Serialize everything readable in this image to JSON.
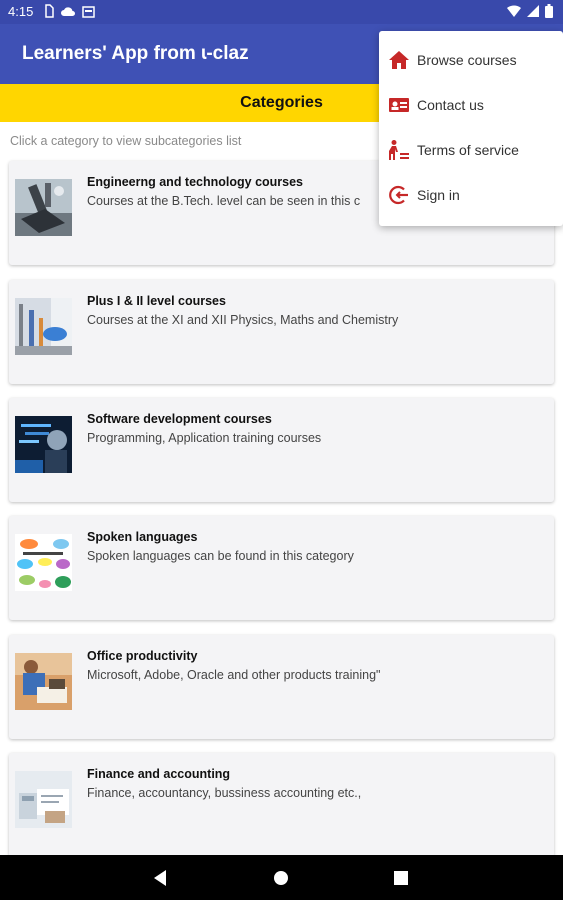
{
  "status": {
    "time": "4:15"
  },
  "app": {
    "title": "Learners' App from ɩ-claz"
  },
  "category_bar": {
    "label": "Categories"
  },
  "hint": "Click a category to view subcategories list",
  "categories": [
    {
      "title": "Engineerng and technology courses",
      "desc": "Courses at the B.Tech. level can be seen in this c",
      "icon": "engineering-thumbnail"
    },
    {
      "title": "Plus I & II level courses",
      "desc": "Courses at the XI and XII Physics, Maths and Chemistry",
      "icon": "lab-thumbnail"
    },
    {
      "title": "Software development courses",
      "desc": "Programming, Application training courses",
      "icon": "software-thumbnail"
    },
    {
      "title": "Spoken languages",
      "desc": "Spoken languages can be found in this category",
      "icon": "languages-thumbnail"
    },
    {
      "title": "Office productivity",
      "desc": "Microsoft,  Adobe, Oracle and other products training\"",
      "icon": "office-thumbnail"
    },
    {
      "title": "Finance and accounting",
      "desc": "Finance, accountancy, bussiness accounting etc.,",
      "icon": "finance-thumbnail"
    }
  ],
  "menu": {
    "items": [
      {
        "label": "Browse courses",
        "icon": "home-icon"
      },
      {
        "label": "Contact us",
        "icon": "contact-card-icon"
      },
      {
        "label": "Terms of service",
        "icon": "terms-icon"
      },
      {
        "label": "Sign in",
        "icon": "sign-in-icon"
      }
    ]
  },
  "colors": {
    "appbar": "#3f51b5",
    "statusbar": "#3949ab",
    "category_bar": "#ffd600",
    "menu_icon": "#c62828"
  }
}
